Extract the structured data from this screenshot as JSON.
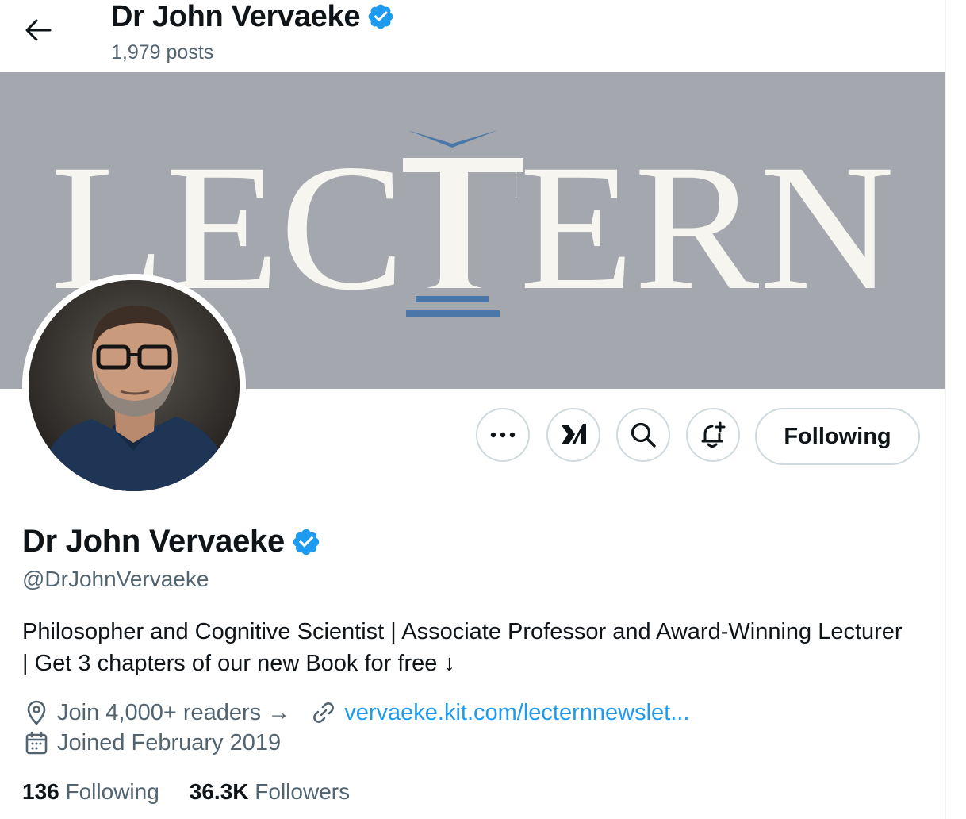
{
  "header": {
    "title": "Dr John Vervaeke",
    "posts_count": "1,979 posts"
  },
  "banner": {
    "text": "LECTERN",
    "bg_color": "#a4a8ae",
    "accent_color": "#4a76a8"
  },
  "actions": {
    "more_icon": "more-icon",
    "grok_icon": "grok-icon",
    "search_icon": "search-icon",
    "notify_icon": "bell-plus-icon",
    "follow_label": "Following"
  },
  "profile": {
    "name": "Dr John Vervaeke",
    "handle": "@DrJohnVervaeke",
    "bio": "Philosopher and Cognitive Scientist | Associate Professor and Award-Winning Lecturer | Get 3 chapters of our new Book for free ↓",
    "location": "Join 4,000+ readers →",
    "url": "vervaeke.kit.com/lecternnewslet...",
    "joined": "Joined February 2019",
    "following_count": "136",
    "following_label": "Following",
    "followers_count": "36.3K",
    "followers_label": "Followers"
  },
  "colors": {
    "verified": "#1d9bf0",
    "link": "#1d9bf0",
    "secondary_text": "#536471"
  }
}
